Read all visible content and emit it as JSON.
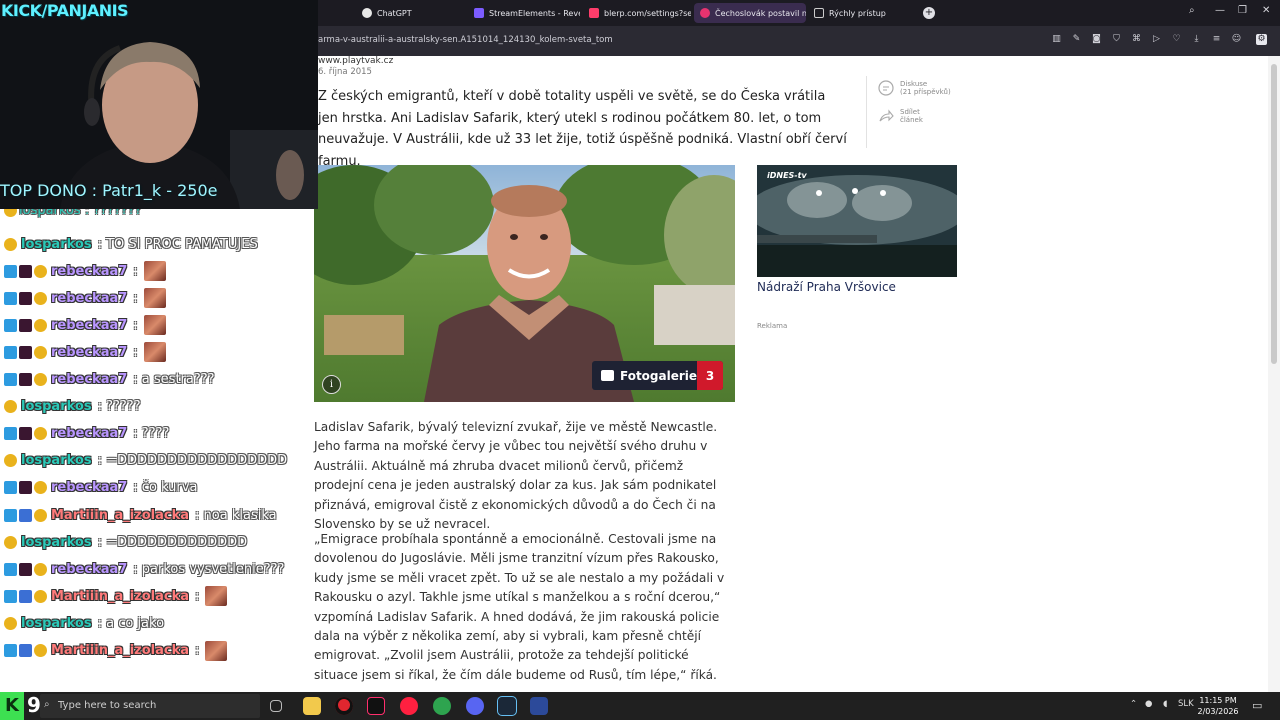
{
  "browser": {
    "tabs": [
      {
        "label": "ChatGPT",
        "active": false
      },
      {
        "label": "StreamElements - Revenue",
        "active": false
      },
      {
        "label": "blerp.com/settings?setting",
        "active": false
      },
      {
        "label": "Čechoslovák postavil nej",
        "active": true
      },
      {
        "label": "Rýchly prístup",
        "active": false
      }
    ],
    "url": "arma-v-australii-a-australsky-sen.A151014_124130_kolem-sveta_tom"
  },
  "article": {
    "source": "www.playtvak.cz",
    "date": "6. října 2015",
    "intro": "Z českých emigrantů, kteří v době totality uspěli ve světě, se do Česka vrátila jen hrstka. Ani Ladislav Safarik, který utekl s rodinou počátkem 80. let, o tom neuvažuje. V Austrálii, kde už 33 let žije, totiž úspěšně podniká. Vlastní obří červí farmu.",
    "discussion_label": "Diskuse",
    "discussion_count": "(21 příspěvků)",
    "share_label_1": "Sdílet",
    "share_label_2": "článek",
    "gallery_label": "Fotogalerie",
    "gallery_count": "3",
    "info_glyph": "i",
    "paragraph_1": "Ladislav Safarik, bývalý televizní zvukař, žije ve městě Newcastle. Jeho farma na mořské červy je vůbec tou největší svého druhu v Austrálii. Aktuálně má zhruba dvacet milionů červů, přičemž prodejní cena je jeden australský dolar za kus. Jak sám podnikatel přiznává, emigroval čistě z ekonomických důvodů a do Čech či na Slovensko by se už nevracel.",
    "paragraph_2": "„Emigrace probíhala spontánně a emocionálně. Cestovali jsme na dovolenou do Jugoslávie. Měli jsme tranzitní vízum přes Rakousko, kudy jsme se měli vracet zpět. To už se ale nestalo a my požádali v Rakousku o azyl. Takhle jsme utíkal s manželkou a s roční dcerou,“ vzpomíná Ladislav Safarik. A hned dodává, že jim rakouská policie dala na výběr z několika zemí, aby si vybrali, kam přesně chtějí emigrovat. „Zvolil jsem Austrálii, protože za tehdejší politické situace jsem si říkal, že čím dále budeme od Rusů, tím lépe,“ říká.",
    "video_tag": "iDNES-tv",
    "video_caption": "Nádraží Praha Vršovice",
    "ad_label": "Reklama"
  },
  "stream": {
    "channel": "KICK/PANJANIS",
    "top_dono": "TOP DONO : Patr1_k - 250e",
    "chat": [
      {
        "user": "losparkos",
        "text": ": TO SI PROC PAMATUJES",
        "badges": [
          "gold"
        ],
        "color": "los",
        "emote": false
      },
      {
        "user": "rebeckaa7",
        "text": ":",
        "badges": [
          "cube",
          "dark",
          "gold"
        ],
        "color": "reb",
        "emote": true
      },
      {
        "user": "rebeckaa7",
        "text": ":",
        "badges": [
          "cube",
          "dark",
          "gold"
        ],
        "color": "reb",
        "emote": true
      },
      {
        "user": "rebeckaa7",
        "text": ":",
        "badges": [
          "cube",
          "dark",
          "gold"
        ],
        "color": "reb",
        "emote": true
      },
      {
        "user": "rebeckaa7",
        "text": ":",
        "badges": [
          "cube",
          "dark",
          "gold"
        ],
        "color": "reb",
        "emote": true
      },
      {
        "user": "rebeckaa7",
        "text": ": a sestra???",
        "badges": [
          "cube",
          "dark",
          "gold"
        ],
        "color": "reb",
        "emote": false
      },
      {
        "user": "losparkos",
        "text": ": ?????",
        "badges": [
          "gold"
        ],
        "color": "los",
        "emote": false
      },
      {
        "user": "rebeckaa7",
        "text": ": ????",
        "badges": [
          "cube",
          "dark",
          "gold"
        ],
        "color": "reb",
        "emote": false
      },
      {
        "user": "losparkos",
        "text": ": =DDDDDDDDDDDDDDDDD",
        "badges": [
          "gold"
        ],
        "color": "los",
        "emote": false
      },
      {
        "user": "rebeckaa7",
        "text": ": čo kurva",
        "badges": [
          "cube",
          "dark",
          "gold"
        ],
        "color": "reb",
        "emote": false
      },
      {
        "user": "Martiiin_a_izolacka",
        "text": ": noa klasika",
        "badges": [
          "cube",
          "snd",
          "gold"
        ],
        "color": "mar",
        "emote": false
      },
      {
        "user": "losparkos",
        "text": ": =DDDDDDDDDDDDD",
        "badges": [
          "gold"
        ],
        "color": "los",
        "emote": false
      },
      {
        "user": "rebeckaa7",
        "text": ": parkos vysvetlenie???",
        "badges": [
          "cube",
          "dark",
          "gold"
        ],
        "color": "reb",
        "emote": false
      },
      {
        "user": "Martiiin_a_izolacka",
        "text": ":",
        "badges": [
          "cube",
          "snd",
          "gold"
        ],
        "color": "mar",
        "emote": true
      },
      {
        "user": "losparkos",
        "text": ": a co jako",
        "badges": [
          "gold"
        ],
        "color": "los",
        "emote": false
      },
      {
        "user": "Martiiin_a_izolacka",
        "text": ":",
        "badges": [
          "cube",
          "snd",
          "gold"
        ],
        "color": "mar",
        "emote": true
      }
    ],
    "chat_top_partial": "losparkos : ???????"
  },
  "taskbar": {
    "logo_letter": "K",
    "badge_number": "9",
    "search_placeholder": "Type here to search",
    "lang": "SLK",
    "time": "11:15 PM",
    "date": "2/03/2026"
  }
}
